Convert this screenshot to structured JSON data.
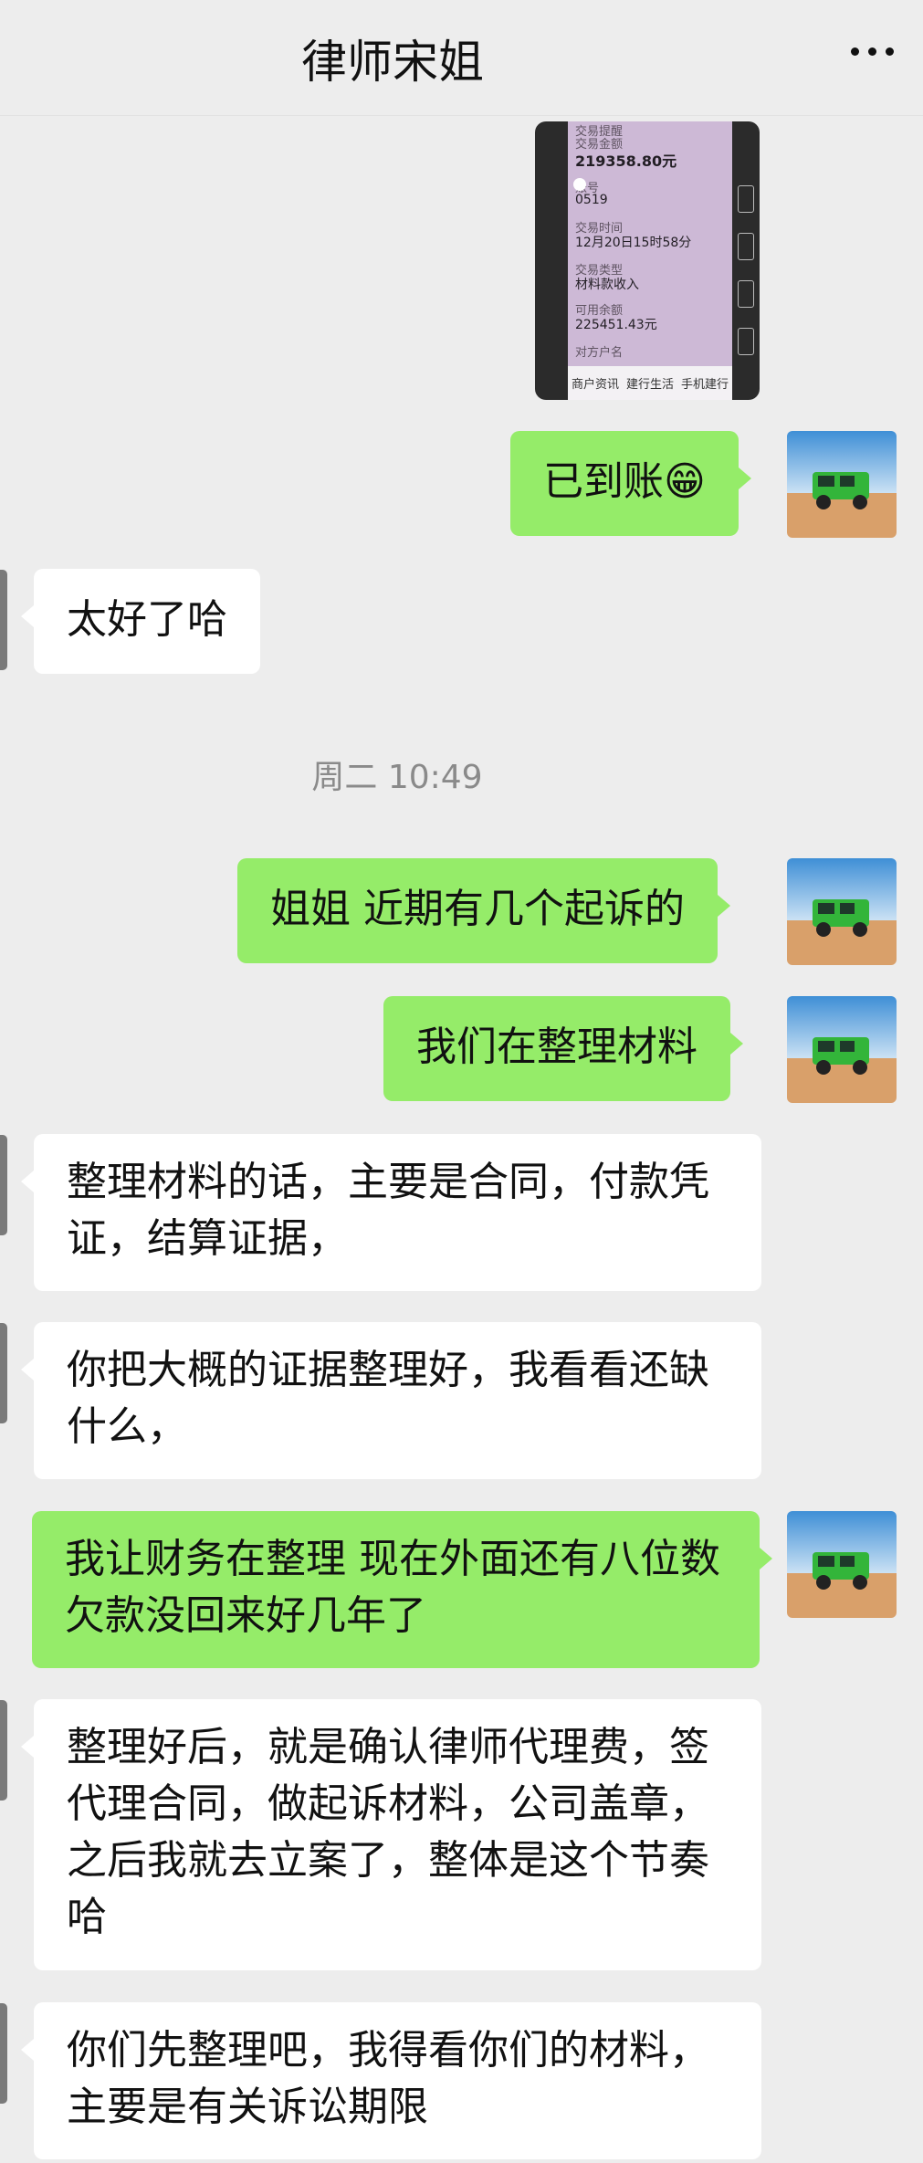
{
  "header": {
    "title": "律师宋姐"
  },
  "screenshot": {
    "lines": [
      {
        "label": "交易提醒",
        "value": ""
      },
      {
        "label": "交易金额",
        "value": "219358.80元"
      },
      {
        "label": "账号",
        "value": "0519"
      },
      {
        "label": "交易时间",
        "value": "12月20日15时58分"
      },
      {
        "label": "交易类型",
        "value": "材料款收入"
      },
      {
        "label": "可用余额",
        "value": "225451.43元"
      },
      {
        "label": "对方户名",
        "value": ""
      }
    ],
    "tabs": [
      "商户资讯",
      "建行生活",
      "手机建行"
    ]
  },
  "messages": {
    "m1": {
      "text": "已到账",
      "emoji": "😁"
    },
    "m2": "太好了哈",
    "timestamp": "周二 10:49",
    "m3": "姐姐 近期有几个起诉的",
    "m4": "我们在整理材料",
    "m5": "整理材料的话，主要是合同，付款凭证，结算证据，",
    "m6": "你把大概的证据整理好，我看看还缺什么，",
    "m7": "我让财务在整理 现在外面还有八位数欠款没回来好几年了",
    "m8": "整理好后，就是确认律师代理费，签代理合同，做起诉材料，公司盖章，之后我就去立案了，整体是这个节奏哈",
    "m9": "你们先整理吧，我得看你们的材料，主要是有关诉讼期限"
  }
}
